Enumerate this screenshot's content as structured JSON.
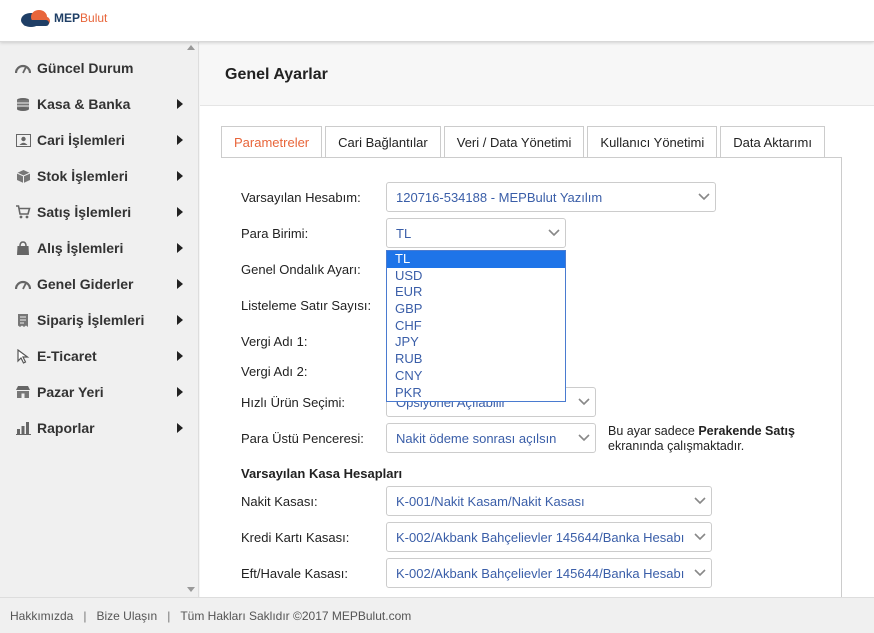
{
  "brand": {
    "mep": "MEP",
    "bulut": "Bulut"
  },
  "sidebar": {
    "items": [
      {
        "label": "Güncel Durum",
        "icon": "dashboard-icon",
        "has_submenu": false
      },
      {
        "label": "Kasa & Banka",
        "icon": "coins-icon",
        "has_submenu": true
      },
      {
        "label": "Cari İşlemleri",
        "icon": "contact-card-icon",
        "has_submenu": true
      },
      {
        "label": "Stok İşlemleri",
        "icon": "box-icon",
        "has_submenu": true
      },
      {
        "label": "Satış İşlemleri",
        "icon": "cart-icon",
        "has_submenu": true
      },
      {
        "label": "Alış İşlemleri",
        "icon": "bag-icon",
        "has_submenu": true
      },
      {
        "label": "Genel Giderler",
        "icon": "dashboard-icon",
        "has_submenu": true
      },
      {
        "label": "Sipariş İşlemleri",
        "icon": "receipt-icon",
        "has_submenu": true
      },
      {
        "label": "E-Ticaret",
        "icon": "cursor-icon",
        "has_submenu": true
      },
      {
        "label": "Pazar Yeri",
        "icon": "store-icon",
        "has_submenu": true
      },
      {
        "label": "Raporlar",
        "icon": "bar-chart-icon",
        "has_submenu": true
      }
    ]
  },
  "page": {
    "title": "Genel Ayarlar"
  },
  "tabs": [
    {
      "label": "Parametreler",
      "active": true
    },
    {
      "label": "Cari Bağlantılar",
      "active": false
    },
    {
      "label": "Veri / Data Yönetimi",
      "active": false
    },
    {
      "label": "Kullanıcı Yönetimi",
      "active": false
    },
    {
      "label": "Data Aktarımı",
      "active": false
    }
  ],
  "form": {
    "varsayilan_hesabim": {
      "label": "Varsayılan Hesabım:",
      "value": "120716-534188 - MEPBulut Yazılım"
    },
    "para_birimi": {
      "label": "Para Birimi:",
      "value": "TL"
    },
    "ondalik": {
      "label": "Genel Ondalık Ayarı:"
    },
    "satir_sayisi": {
      "label": "Listeleme Satır Sayısı:"
    },
    "vergi_adi_1": {
      "label": "Vergi Adı 1:"
    },
    "vergi_adi_2": {
      "label": "Vergi Adı 2:"
    },
    "hizli_urun": {
      "label": "Hızlı Ürün Seçimi:",
      "value": "Opsiyonel Açılabilir"
    },
    "para_ustu": {
      "label": "Para Üstü Penceresi:",
      "value": "Nakit ödeme sonrası açılsın"
    },
    "note": {
      "prefix": "Bu ayar sadece ",
      "bold": "Perakende Satış",
      "suffix": "ekranında çalışmaktadır."
    },
    "kasa_section": "Varsayılan Kasa Hesapları",
    "nakit_kasasi": {
      "label": "Nakit Kasası:",
      "value": "K-001/Nakit Kasam/Nakit Kasası"
    },
    "kredi_karti_kasasi": {
      "label": "Kredi Kartı Kasası:",
      "value": "K-002/Akbank Bahçelievler 145644/Banka Hesabı"
    },
    "eft_kasasi": {
      "label": "Eft/Havale Kasası:",
      "value": "K-002/Akbank Bahçelievler 145644/Banka Hesabı"
    }
  },
  "currency_dropdown": {
    "options": [
      "TL",
      "USD",
      "EUR",
      "GBP",
      "CHF",
      "JPY",
      "RUB",
      "CNY",
      "PKR"
    ],
    "selected": "TL"
  },
  "footer": {
    "about": "Hakkımızda",
    "contact": "Bize Ulaşın",
    "copyright": "Tüm Hakları Saklıdır ©2017 MEPBulut.com"
  },
  "colors": {
    "accent": "#e8653a",
    "link": "#3a5ea8",
    "selection": "#1e74e8",
    "brand_dark": "#1f3f66"
  }
}
